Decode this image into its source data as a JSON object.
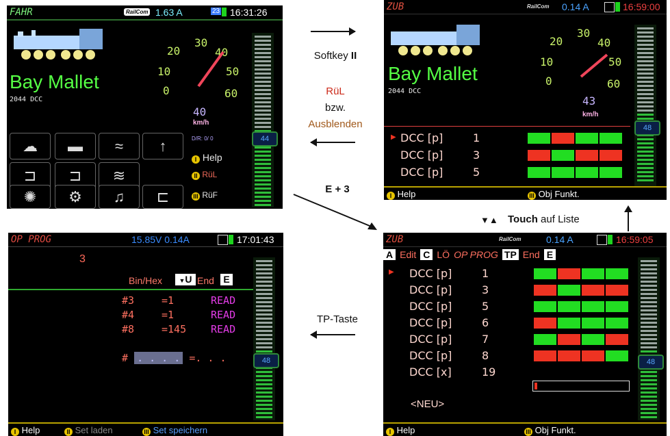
{
  "screen_fahr": {
    "title": "FAHR",
    "railcom": "RailCom",
    "current": "1.63 A",
    "slot": "23",
    "time": "16:31:26",
    "loco_name": "Bay Mallet",
    "loco_sub": "2044 DCC",
    "speed": "40",
    "unit": "km/h",
    "dial_labels": [
      "0",
      "10",
      "20",
      "30",
      "40",
      "50",
      "60"
    ],
    "dir_info": "D/R: 0/ 0",
    "slider_value": "44",
    "menu": [
      {
        "label": "Help",
        "num": "I"
      },
      {
        "label": "RüL",
        "num": "II"
      },
      {
        "label": "RüF",
        "num": "III"
      }
    ]
  },
  "screen_zub": {
    "title": "ZUB",
    "railcom": "RailCom",
    "current": "0.14 A",
    "time": "16:59:00",
    "loco_name": "Bay Mallet",
    "loco_sub": "2044 DCC",
    "speed": "43",
    "unit": "km/h",
    "dial_labels": [
      "0",
      "10",
      "20",
      "30",
      "40",
      "50",
      "60"
    ],
    "slider_value": "48",
    "rows": [
      {
        "type": "DCC [p]",
        "num": "1",
        "blocks": [
          "g",
          "r",
          "g",
          "g"
        ]
      },
      {
        "type": "DCC [p]",
        "num": "3",
        "blocks": [
          "r",
          "g",
          "r",
          "r"
        ]
      },
      {
        "type": "DCC [p]",
        "num": "5",
        "blocks": [
          "g",
          "g",
          "g",
          "g"
        ]
      }
    ],
    "softkeys": {
      "left": "Help",
      "right": "Obj Funkt."
    }
  },
  "screen_prog": {
    "title": "OP PROG",
    "voltage": "15.85V 0.14A",
    "time": "17:01:43",
    "address": "3",
    "binhex": "Bin/Hex",
    "u": "U",
    "end": "End",
    "e": "E",
    "rows": [
      {
        "cv": "#3",
        "val": "=1",
        "status": "READ"
      },
      {
        "cv": "#4",
        "val": "=1",
        "status": "READ"
      },
      {
        "cv": "#8",
        "val": "=145",
        "status": "READ"
      }
    ],
    "input_row": {
      "cv": "#",
      "placeholder": ". . . .",
      "val": "=. . ."
    },
    "slider_value": "48",
    "softkeys": {
      "k1": "Help",
      "k2": "Set laden",
      "k3": "Set speichern"
    }
  },
  "screen_zub2": {
    "title": "ZUB",
    "railcom": "RailCom",
    "current": "0.14 A",
    "time": "16:59:05",
    "menu": {
      "a": "A",
      "edit": "Edit",
      "c": "C",
      "lo": "LÖ",
      "op": "OP PROG",
      "tp": "TP",
      "end": "End",
      "e": "E"
    },
    "rows": [
      {
        "type": "DCC [p]",
        "num": "1",
        "blocks": [
          "g",
          "r",
          "g",
          "g"
        ]
      },
      {
        "type": "DCC [p]",
        "num": "3",
        "blocks": [
          "r",
          "g",
          "r",
          "r"
        ]
      },
      {
        "type": "DCC [p]",
        "num": "5",
        "blocks": [
          "g",
          "g",
          "g",
          "g"
        ]
      },
      {
        "type": "DCC [p]",
        "num": "6",
        "blocks": [
          "r",
          "g",
          "g",
          "g"
        ]
      },
      {
        "type": "DCC [p]",
        "num": "7",
        "blocks": [
          "g",
          "r",
          "g",
          "r"
        ]
      },
      {
        "type": "DCC [p]",
        "num": "8",
        "blocks": [
          "r",
          "r",
          "r",
          "g"
        ]
      },
      {
        "type": "DCC [x]",
        "num": "19",
        "blocks": []
      }
    ],
    "neu": "<NEU>",
    "slider_value": "48",
    "softkeys": {
      "left": "Help",
      "right": "Obj Funkt."
    }
  },
  "annotations": {
    "softkey": "Softkey ",
    "softkey_bold": "II",
    "rul": "RüL",
    "bzw": "bzw.",
    "ausblenden": "Ausblenden",
    "e3": "E + 3",
    "touch_bold": "Touch",
    "touch_rest": " auf Liste",
    "tp": "TP-Taste"
  },
  "colors": {
    "green": "#22dd22",
    "red": "#ee3322",
    "loco_name": "#55ff44",
    "magenta": "#e43ce8"
  }
}
